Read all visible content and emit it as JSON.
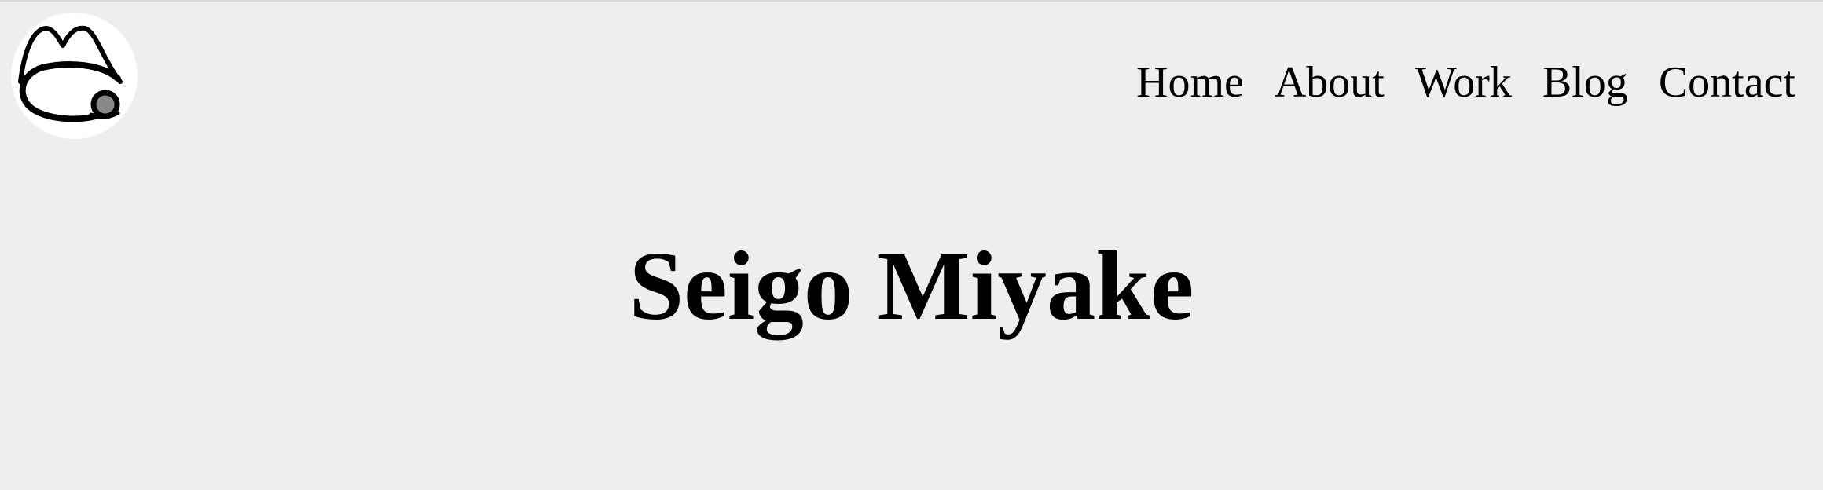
{
  "colors": {
    "background": "#eeeeee",
    "text": "#000000",
    "logo_background": "#ffffff",
    "logo_dot": "#888888"
  },
  "logo": {
    "icon": "cat-face-logo-icon"
  },
  "nav": {
    "items": [
      {
        "label": "Home"
      },
      {
        "label": "About"
      },
      {
        "label": "Work"
      },
      {
        "label": "Blog"
      },
      {
        "label": "Contact"
      }
    ]
  },
  "hero": {
    "title": "Seigo Miyake"
  }
}
